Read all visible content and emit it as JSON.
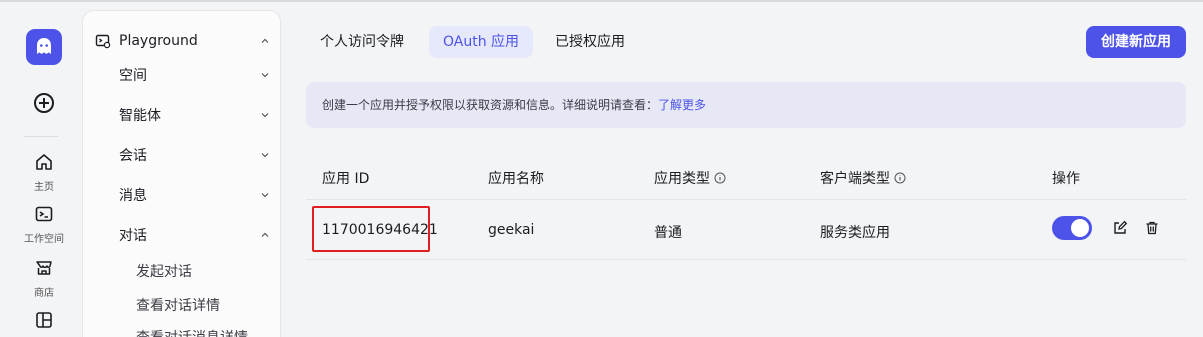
{
  "rail": {
    "items": [
      {
        "label": "主页",
        "icon": "home-icon"
      },
      {
        "label": "工作空间",
        "icon": "terminal-icon"
      },
      {
        "label": "商店",
        "icon": "store-icon"
      },
      {
        "label": "",
        "icon": "layout-icon"
      }
    ]
  },
  "sidebar": {
    "playground": "Playground",
    "sections": [
      {
        "label": "空间"
      },
      {
        "label": "智能体"
      },
      {
        "label": "会话"
      },
      {
        "label": "消息"
      },
      {
        "label": "对话"
      }
    ],
    "sub_items": [
      "发起对话",
      "查看对话详情",
      "查看对话消息详情"
    ]
  },
  "tabs": [
    {
      "label": "个人访问令牌"
    },
    {
      "label": "OAuth 应用"
    },
    {
      "label": "已授权应用"
    }
  ],
  "create_button": "创建新应用",
  "info": {
    "text": "创建一个应用并授予权限以获取资源和信息。详细说明请查看：",
    "link": "了解更多"
  },
  "table": {
    "headers": [
      "应用 ID",
      "应用名称",
      "应用类型",
      "客户端类型",
      "操作"
    ],
    "rows": [
      {
        "id": "1170016946421",
        "name": "geekai",
        "type": "普通",
        "client_type": "服务类应用",
        "enabled": true
      }
    ]
  },
  "colors": {
    "accent": "#4d53e8",
    "highlight": "#e02020"
  }
}
